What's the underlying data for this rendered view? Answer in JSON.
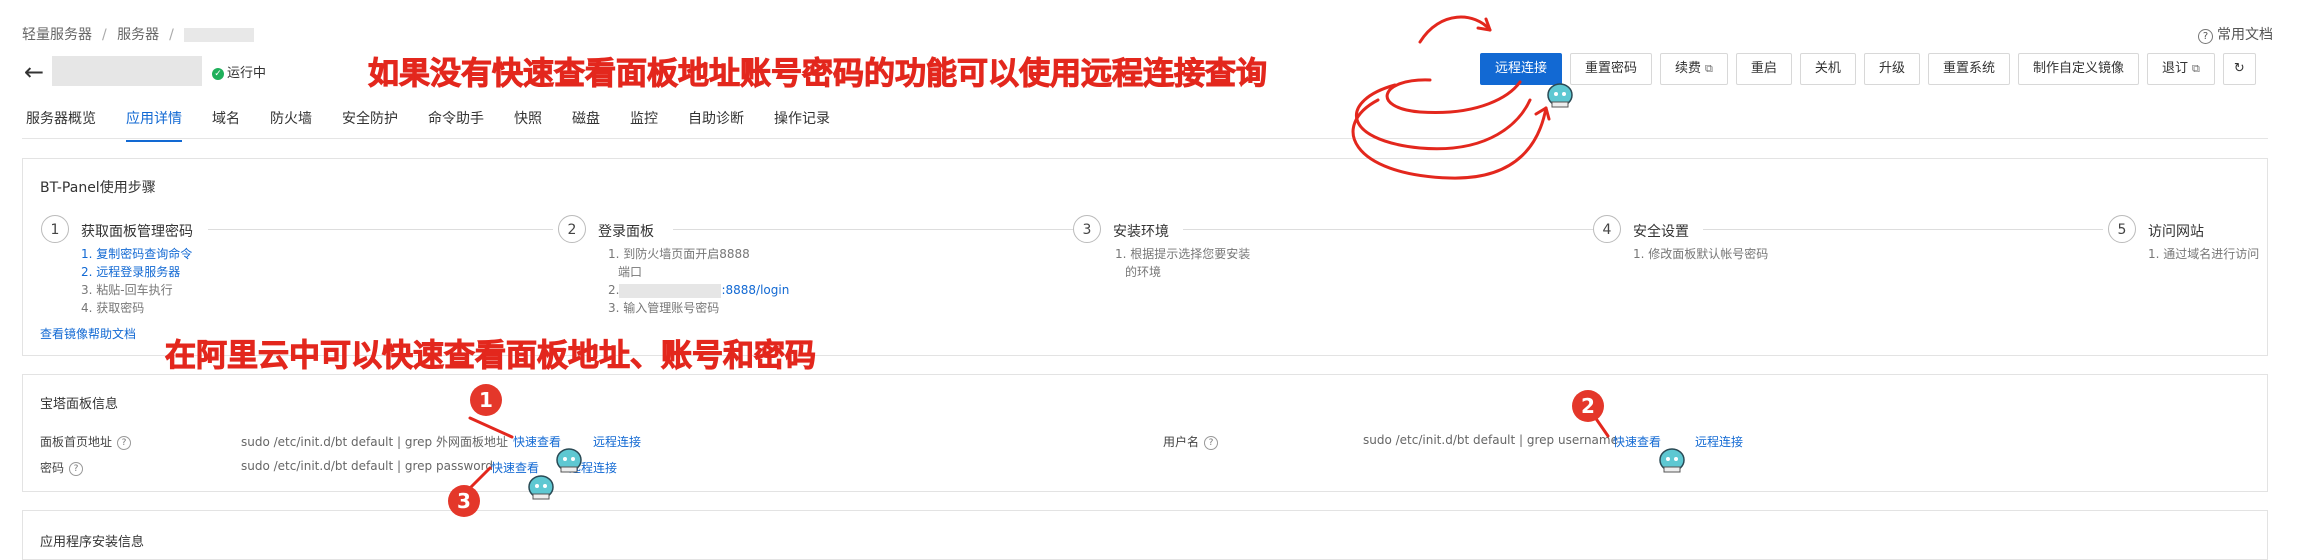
{
  "breadcrumb": {
    "items": [
      "轻量服务器",
      "服务器"
    ]
  },
  "help": {
    "label": "常用文档"
  },
  "server": {
    "status": "运行中"
  },
  "toolbar": {
    "buttons": [
      "远程连接",
      "重置密码",
      "续费",
      "重启",
      "关机",
      "升级",
      "重置系统",
      "制作自定义镜像",
      "退订"
    ]
  },
  "tabs": [
    "服务器概览",
    "应用详情",
    "域名",
    "防火墙",
    "安全防护",
    "命令助手",
    "快照",
    "磁盘",
    "监控",
    "自助诊断",
    "操作记录"
  ],
  "bt_steps": {
    "title": "BT-Panel使用步骤",
    "steps": [
      {
        "num": "1",
        "title": "获取面板管理密码",
        "lines": [
          "1. 复制密码查询命令",
          "2. 远程登录服务器",
          "3. 粘贴-回车执行",
          "4. 获取密码"
        ]
      },
      {
        "num": "2",
        "title": "登录面板",
        "lines": [
          "1. 到防火墙页面开启8888",
          "端口",
          "2.",
          ":8888/login",
          "3. 输入管理账号密码"
        ]
      },
      {
        "num": "3",
        "title": "安装环境",
        "lines": [
          "1. 根据提示选择您要安装",
          "的环境"
        ]
      },
      {
        "num": "4",
        "title": "安全设置",
        "lines": [
          "1. 修改面板默认帐号密码"
        ]
      },
      {
        "num": "5",
        "title": "访问网站",
        "lines": [
          "1. 通过域名进行访问"
        ]
      }
    ],
    "doc_link": "查看镜像帮助文档"
  },
  "panel_info": {
    "title": "宝塔面板信息",
    "home": {
      "label": "面板首页地址",
      "cmd": "sudo /etc/init.d/bt default | grep 外网面板地址",
      "quick": "快速查看",
      "remote": "远程连接"
    },
    "password": {
      "label": "密码",
      "cmd": "sudo /etc/init.d/bt default | grep password",
      "quick": "快速查看",
      "remote": "远程连接"
    },
    "username": {
      "label": "用户名",
      "cmd": "sudo /etc/init.d/bt default | grep username",
      "quick": "快速查看",
      "remote": "远程连接"
    }
  },
  "app_install": {
    "title": "应用程序安装信息"
  },
  "annotations": {
    "top": "如果没有快速查看面板地址账号密码的功能可以使用远程连接查询",
    "middle": "在阿里云中可以快速查看面板地址、账号和密码",
    "n1": "1",
    "n2": "2",
    "n3": "3"
  },
  "colors": {
    "primary": "#1269d3",
    "annotation": "#e3271d",
    "status_green": "#1fb05b"
  }
}
